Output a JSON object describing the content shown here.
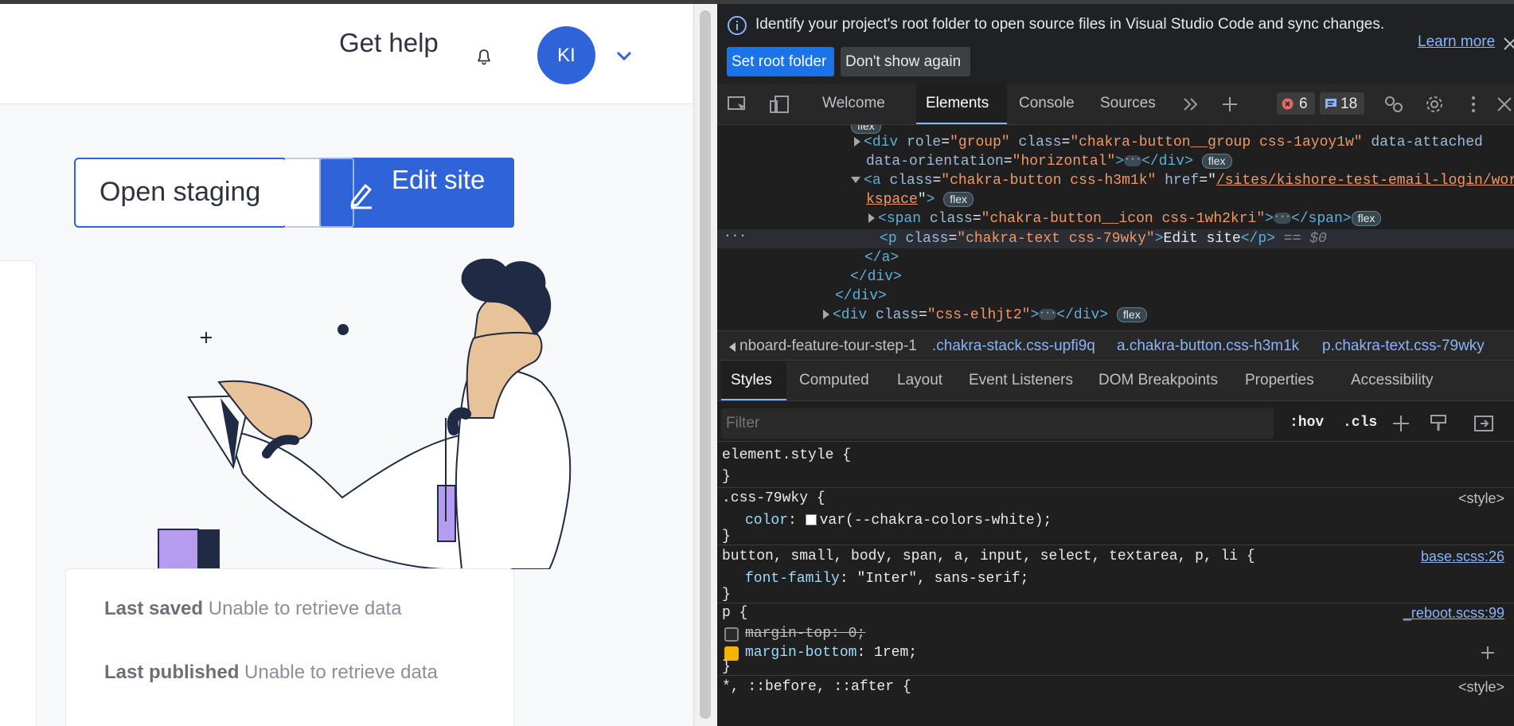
{
  "app": {
    "get_help": "Get help",
    "avatar_initials": "KI",
    "open_staging": "Open staging",
    "edit_site": "Edit site",
    "last_saved_label": "Last saved",
    "last_saved_value": " Unable to retrieve data",
    "last_published_label": "Last published",
    "last_published_value": " Unable to retrieve data",
    "brand_color": "#2f63d8"
  },
  "devtools": {
    "infobar": {
      "message": "Identify your project's root folder to open source files in Visual Studio Code and sync changes.",
      "learn_more": "Learn more",
      "set_root": "Set root folder",
      "dont_show": "Don't show again"
    },
    "tabs": [
      "Welcome",
      "Elements",
      "Console",
      "Sources"
    ],
    "active_tab": "Elements",
    "error_count": "6",
    "message_count": "18",
    "dom": {
      "l0_pill": "flex",
      "l1_a": "div",
      "l1_role": "role",
      "l1_role_v": "\"group\"",
      "l1_class": "class",
      "l1_class_v": "\"chakra-button__group css-1ayoy1w\"",
      "l1_attached": "data-attached",
      "l2_attr": "data-orientation",
      "l2_val": "\"horizontal\"",
      "l2_pill": "flex",
      "l3_tag": "a",
      "l3_class": "class",
      "l3_class_v": "\"chakra-button css-h3m1k\"",
      "l3_href": "href",
      "l3_href_v1": "/sites/kishore-test-email-login/wor",
      "l4_href_v2": "kspace",
      "l4_pill": "flex",
      "l5_tag": "span",
      "l5_class": "class",
      "l5_class_v": "\"chakra-button__icon css-1wh2kri\"",
      "l5_pill": "flex",
      "l6_tag": "p",
      "l6_class": "class",
      "l6_class_v": "\"chakra-text css-79wky\"",
      "l6_text": "Edit site",
      "l6_eq": " == $0",
      "l7": "</a>",
      "l8": "</div>",
      "l9": "</div>",
      "l10_class_v": "\"css-elhjt2\"",
      "l10_pill": "flex"
    },
    "breadcrumbs": [
      "nboard-feature-tour-step-1",
      ".chakra-stack.css-upfi9q",
      "a.chakra-button.css-h3m1k",
      "p.chakra-text.css-79wky"
    ],
    "style_tabs": [
      "Styles",
      "Computed",
      "Layout",
      "Event Listeners",
      "DOM Breakpoints",
      "Properties",
      "Accessibility"
    ],
    "filter_placeholder": "Filter",
    "hov": ":hov",
    "cls": ".cls",
    "styles": {
      "r1_sel": "element.style {",
      "r1_end": "}",
      "r2_sel": ".css-79wky {",
      "r2_src": "<style>",
      "r2_prop": "color",
      "r2_val": "var(--chakra-colors-white);",
      "r2_end": "}",
      "r3_sel": "button, small, body, span, a, input, select, textarea, p, li {",
      "r3_src": "base.scss:26",
      "r3_prop": "font-family",
      "r3_val": "\"Inter\", sans-serif;",
      "r3_end": "}",
      "r4_sel": "p {",
      "r4_src": "_reboot.scss:99",
      "r4_p1": "margin-top: 0;",
      "r4_p2_prop": "margin-bottom",
      "r4_p2_val": "1rem;",
      "r4_end": "}",
      "r5_sel": "*, ::before, ::after {",
      "r5_src": "<style>"
    }
  }
}
